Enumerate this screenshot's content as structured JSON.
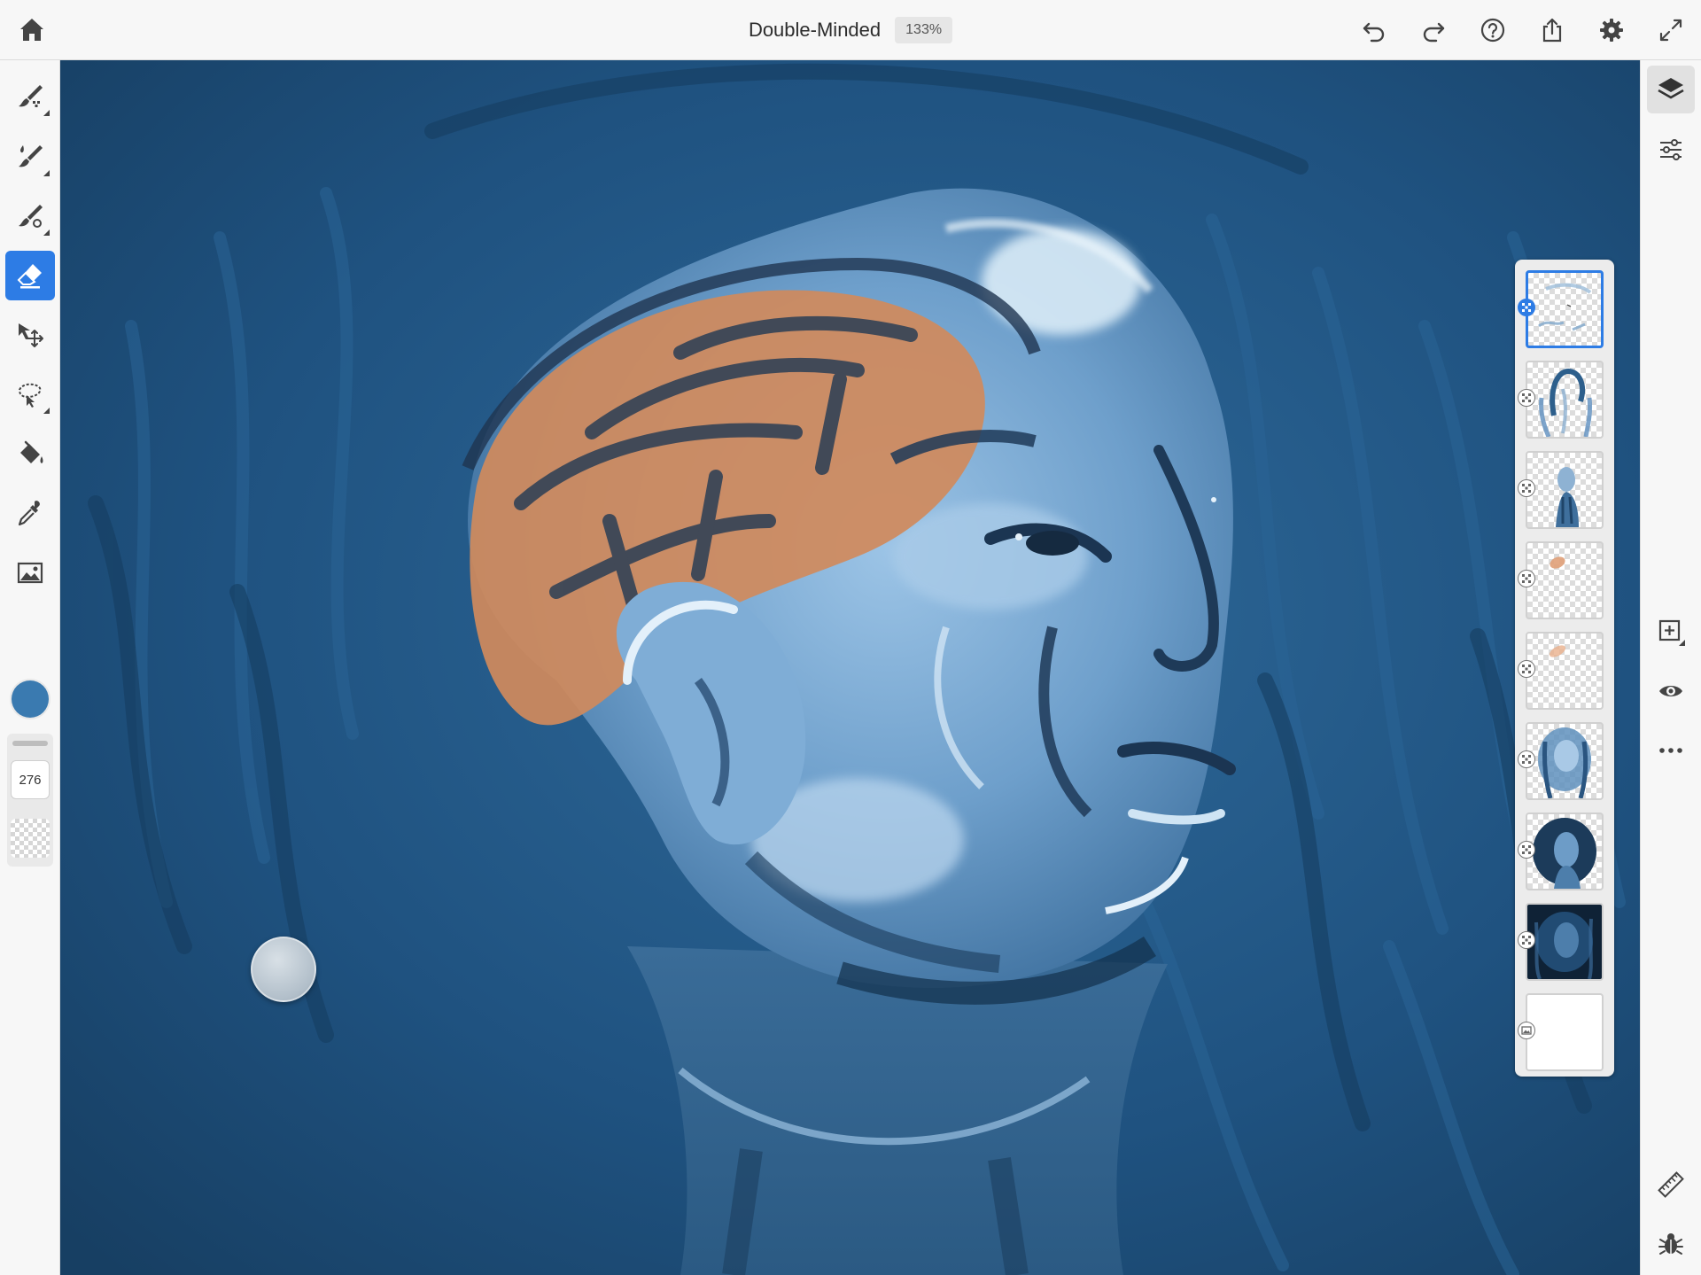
{
  "app": {
    "document_title": "Double-Minded",
    "zoom_label": "133%"
  },
  "toolbar_top": {
    "icons": [
      "home-icon",
      "undo-icon",
      "redo-icon",
      "help-icon",
      "share-icon",
      "settings-icon",
      "fullscreen-icon"
    ]
  },
  "left_tools": [
    {
      "name": "pixel-brush-icon",
      "active": false
    },
    {
      "name": "live-brush-icon",
      "active": false
    },
    {
      "name": "vector-brush-icon",
      "active": false
    },
    {
      "name": "eraser-icon",
      "active": true
    },
    {
      "name": "transform-icon",
      "active": false
    },
    {
      "name": "selection-icon",
      "active": false
    },
    {
      "name": "fill-icon",
      "active": false
    },
    {
      "name": "eyedropper-icon",
      "active": false
    },
    {
      "name": "place-image-icon",
      "active": false
    }
  ],
  "brush": {
    "color": "#3a7ab0",
    "size_value": "276"
  },
  "right_rail": {
    "icons": [
      "layers-icon",
      "layer-properties-icon",
      "add-layer-icon",
      "visibility-icon",
      "more-icon",
      "ruler-icon",
      "debug-icon"
    ]
  },
  "layers": [
    {
      "name": "layer-1",
      "selected": true,
      "type": "pixel"
    },
    {
      "name": "layer-2",
      "selected": false,
      "type": "pixel"
    },
    {
      "name": "layer-3",
      "selected": false,
      "type": "pixel"
    },
    {
      "name": "layer-4",
      "selected": false,
      "type": "pixel"
    },
    {
      "name": "layer-5",
      "selected": false,
      "type": "pixel"
    },
    {
      "name": "layer-6",
      "selected": false,
      "type": "pixel"
    },
    {
      "name": "layer-7",
      "selected": false,
      "type": "pixel"
    },
    {
      "name": "layer-8",
      "selected": false,
      "type": "pixel"
    },
    {
      "name": "background-layer",
      "selected": false,
      "type": "background"
    }
  ],
  "colors": {
    "accent": "#2d7ce5",
    "canvas_dark": "#1f4f78",
    "skin_light": "#8fb9de",
    "brain_orange": "#d08a5c"
  }
}
